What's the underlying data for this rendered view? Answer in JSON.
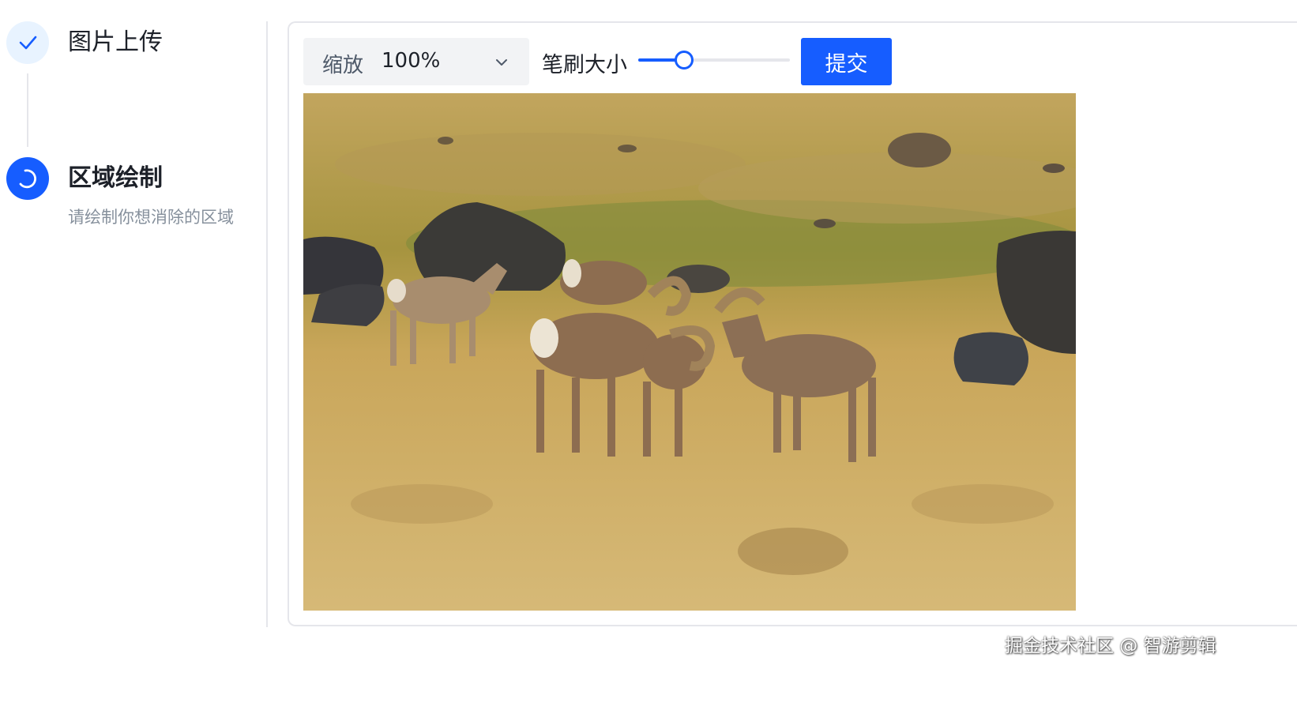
{
  "steps": [
    {
      "title": "图片上传",
      "status": "finish",
      "icon": "check-icon"
    },
    {
      "title": "区域绘制",
      "description": "请绘制你想消除的区域",
      "status": "process",
      "icon": "loading-icon"
    }
  ],
  "toolbar": {
    "zoom_label": "缩放",
    "zoom_value": "100%",
    "brush_label": "笔刷大小",
    "brush_size": 0.3,
    "submit_label": "提交"
  },
  "canvas": {
    "image": "bighorn sheep herd on dry grassland"
  },
  "watermark": "掘金技术社区 @ 智游剪辑",
  "colors": {
    "primary": "#165dff",
    "step_finished_bg": "#e8f3ff",
    "muted_text": "#86909c"
  }
}
